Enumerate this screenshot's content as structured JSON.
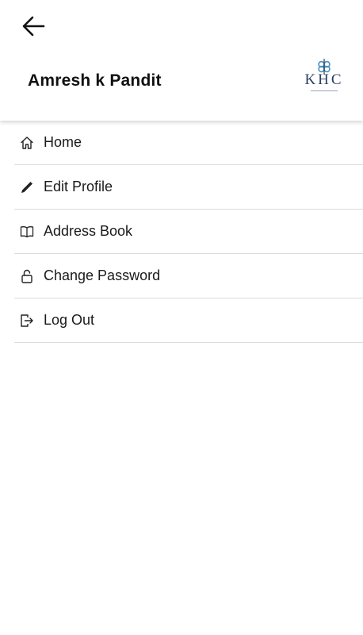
{
  "header": {
    "user_name": "Amresh k Pandit",
    "logo_text": "KHC",
    "back_icon": "arrow-left-icon"
  },
  "menu": {
    "items": [
      {
        "label": "Home",
        "icon": "home-icon"
      },
      {
        "label": "Edit Profile",
        "icon": "pencil-icon"
      },
      {
        "label": "Address Book",
        "icon": "book-icon"
      },
      {
        "label": "Change Password",
        "icon": "lock-icon"
      },
      {
        "label": "Log Out",
        "icon": "logout-icon"
      }
    ]
  },
  "colors": {
    "brand_navy": "#2d3f63",
    "brand_teal": "#4a8fc0",
    "divider": "#dcdcdc",
    "text": "#111111"
  }
}
